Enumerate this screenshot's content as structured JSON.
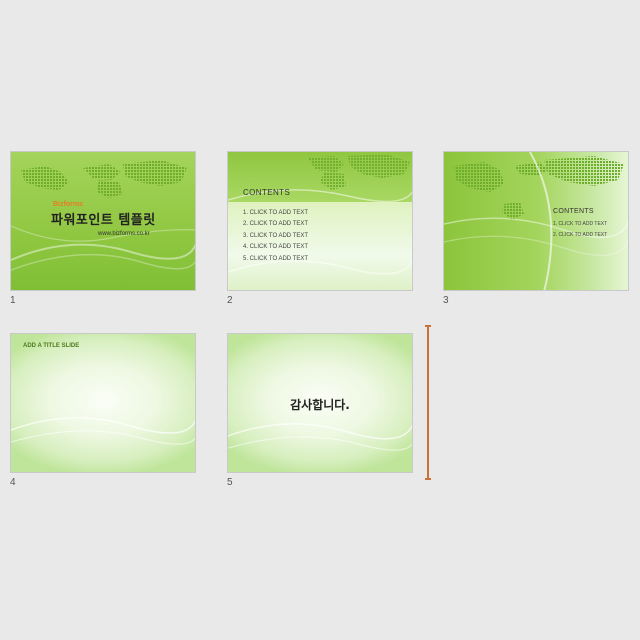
{
  "slides": [
    {
      "number": "1",
      "brand": "Bizforms",
      "title": "파워포인트 템플릿",
      "url": "www.bizforms.co.kr"
    },
    {
      "number": "2",
      "heading": "CONTENTS",
      "items": [
        "1. CLICK TO ADD TEXT",
        "2. CLICK TO ADD TEXT",
        "3. CLICK TO ADD TEXT",
        "4. CLICK TO ADD TEXT",
        "5. CLICK TO ADD TEXT"
      ]
    },
    {
      "number": "3",
      "heading": "CONTENTS",
      "items": [
        "1. CLICK TO ADD TEXT",
        "2. CLICK TO ADD TEXT"
      ]
    },
    {
      "number": "4",
      "title": "ADD A TITLE SLIDE"
    },
    {
      "number": "5",
      "text": "감사합니다."
    }
  ],
  "colors": {
    "background": "#e9e9e9",
    "brand": "#e67e22",
    "insertion_marker": "#c8713a",
    "slide_green": "#92c843"
  }
}
